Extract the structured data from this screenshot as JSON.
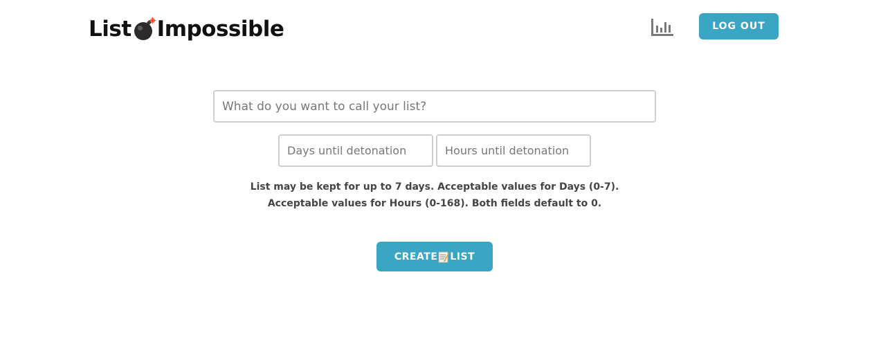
{
  "header": {
    "logo_word_1": "List",
    "logo_word_2": "Impossible",
    "logo_icon": "bomb-icon",
    "stats_icon": "bar-chart-icon",
    "logout_label": "LOG OUT"
  },
  "form": {
    "list_name_placeholder": "What do you want to call your list?",
    "list_name_value": "",
    "days_placeholder": "Days until detonation",
    "days_value": "",
    "hours_placeholder": "Hours until detonation",
    "hours_value": "",
    "help_text": "List may be kept for up to 7 days. Acceptable values for Days (0-7). Acceptable values for Hours (0-168). Both fields default to 0.",
    "create_label_part1": "CREATE",
    "create_icon": "memo-icon",
    "create_label_part2": "LIST"
  },
  "colors": {
    "accent": "#3aa6c4",
    "text": "#444444",
    "input_border": "#cfcfcf"
  }
}
